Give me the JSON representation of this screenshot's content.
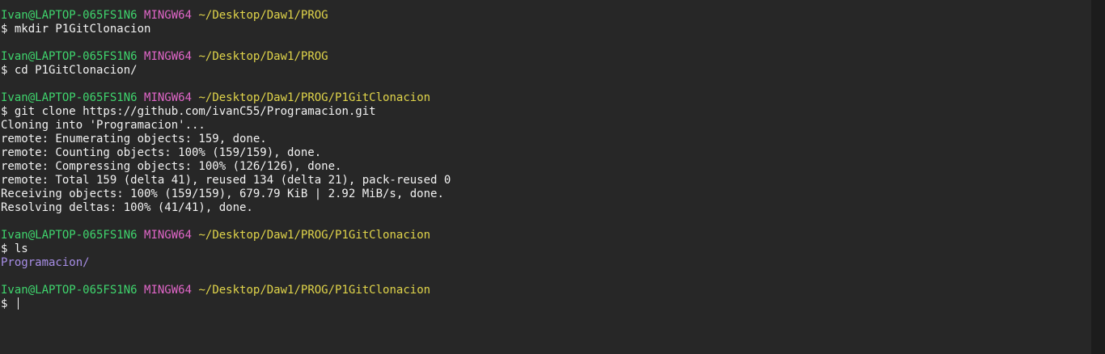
{
  "prompt": {
    "user_host": "Ivan@LAPTOP-065FS1N6",
    "shell": "MINGW64",
    "symbol": "$ "
  },
  "colors": {
    "background": "#272727",
    "text": "#f2f2f2",
    "user_host": "#3fd56d",
    "shell": "#e066c8",
    "path": "#e0d44a",
    "directory": "#a78ee6"
  },
  "session": [
    {
      "path": "~/Desktop/Daw1/PROG",
      "command": "mkdir P1GitClonacion",
      "output": []
    },
    {
      "path": "~/Desktop/Daw1/PROG",
      "command": "cd P1GitClonacion/",
      "output": []
    },
    {
      "path": "~/Desktop/Daw1/PROG/P1GitClonacion",
      "command": "git clone https://github.com/ivanC55/Programacion.git",
      "output": [
        "Cloning into 'Programacion'...",
        "remote: Enumerating objects: 159, done.",
        "remote: Counting objects: 100% (159/159), done.",
        "remote: Compressing objects: 100% (126/126), done.",
        "remote: Total 159 (delta 41), reused 134 (delta 21), pack-reused 0",
        "Receiving objects: 100% (159/159), 679.79 KiB | 2.92 MiB/s, done.",
        "Resolving deltas: 100% (41/41), done."
      ]
    },
    {
      "path": "~/Desktop/Daw1/PROG/P1GitClonacion",
      "command": "ls",
      "output_dirs": [
        "Programacion/"
      ]
    },
    {
      "path": "~/Desktop/Daw1/PROG/P1GitClonacion",
      "command": "",
      "active": true
    }
  ]
}
